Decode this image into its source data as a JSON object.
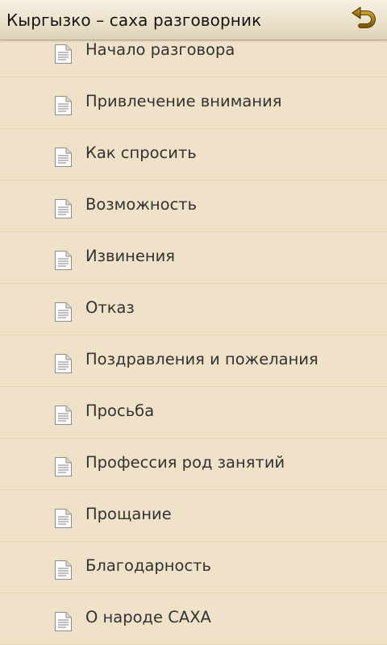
{
  "header": {
    "title": "Кыргызко – саха разговорник",
    "back_icon": "back-arrow-icon",
    "back_icon_color": "#8a6a10"
  },
  "list": {
    "item_icon": "document-icon",
    "items": [
      {
        "label": "Начало разговора"
      },
      {
        "label": "Привлечение внимания"
      },
      {
        "label": "Как спросить"
      },
      {
        "label": "Возможность"
      },
      {
        "label": "Извинения"
      },
      {
        "label": "Отказ"
      },
      {
        "label": "Поздравления и пожелания"
      },
      {
        "label": "Просьба"
      },
      {
        "label": "Профессия род занятий"
      },
      {
        "label": "Прощание"
      },
      {
        "label": "Благодарность"
      },
      {
        "label": "О народе САХА"
      }
    ]
  },
  "colors": {
    "background": "#efe2c8",
    "text": "#333333",
    "divider": "#e6d6b6"
  }
}
